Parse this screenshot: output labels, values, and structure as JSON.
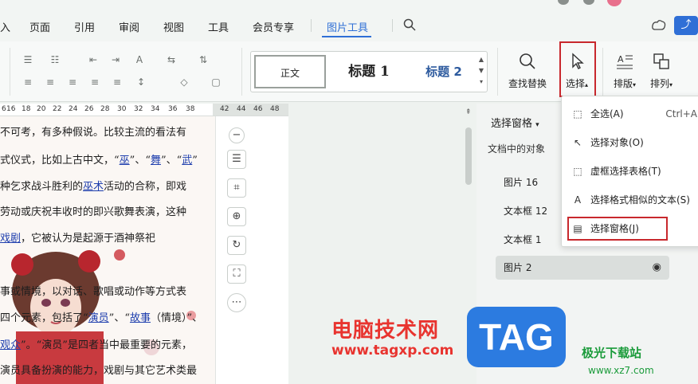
{
  "menu": {
    "items": [
      "入",
      "页面",
      "引用",
      "审阅",
      "视图",
      "工具",
      "会员专享",
      "图片工具"
    ],
    "active_index": 7
  },
  "ribbon": {
    "styles": {
      "normal": "正文",
      "heading1": "标题 1",
      "heading2": "标题 2"
    },
    "find_replace": "查找替换",
    "select": "选择",
    "arrange_text": "排版",
    "arrange": "排列"
  },
  "ruler": {
    "numbers": [
      "6",
      "16",
      "18",
      "20",
      "22",
      "24",
      "26",
      "28",
      "30",
      "32",
      "34",
      "36",
      "38",
      "42",
      "44",
      "46",
      "48"
    ]
  },
  "document": {
    "lines": [
      {
        "parts": [
          {
            "t": "不可考，有多种假说。比较主流的看法有"
          }
        ]
      },
      {
        "parts": [
          {
            "t": "式仪式，比如上古中文，“"
          },
          {
            "t": "巫",
            "link": true
          },
          {
            "t": "”、“"
          },
          {
            "t": "舞",
            "link": true
          },
          {
            "t": "”、“"
          },
          {
            "t": "武",
            "link": true
          },
          {
            "t": "”"
          }
        ]
      },
      {
        "parts": [
          {
            "t": "种乞求战斗胜利的"
          },
          {
            "t": "巫术",
            "link": true
          },
          {
            "t": "活动的合称，即戏"
          }
        ]
      },
      {
        "parts": [
          {
            "t": "劳动或庆祝丰收时的即兴歌舞表演，这种"
          }
        ]
      },
      {
        "parts": [
          {
            "t": "戏剧",
            "link": true
          },
          {
            "t": "，它被认为是起源于酒神祭祀"
          }
        ]
      },
      {
        "parts": [
          {
            "t": "事或情境，以对话、歌唱或动作等方式表"
          }
        ]
      },
      {
        "parts": [
          {
            "t": "四个元素，包括了“"
          },
          {
            "t": "演员",
            "link": true
          },
          {
            "t": "”、“"
          },
          {
            "t": "故事",
            "link": true
          },
          {
            "t": "（情境）”、"
          }
        ]
      },
      {
        "parts": [
          {
            "t": "观众",
            "link": true
          },
          {
            "t": "”。“演员”是四者当中最重要的元素，"
          }
        ]
      },
      {
        "parts": [
          {
            "t": "演员具备扮演的能力，戏剧与其它艺术类最"
          }
        ]
      }
    ]
  },
  "pane": {
    "title": "选择窗格",
    "objects_label": "文档中的对象",
    "objects": [
      "图片 16",
      "文本框 12",
      "文本框 1",
      "图片 2"
    ],
    "selected_index": 3
  },
  "dropdown": {
    "items": [
      {
        "label": "全选(A)",
        "shortcut": "Ctrl+A",
        "icon": "select-all-icon"
      },
      {
        "label": "选择对象(O)",
        "shortcut": "",
        "icon": "pointer-icon"
      },
      {
        "label": "虚框选择表格(T)",
        "shortcut": "",
        "icon": "dashed-box-icon"
      },
      {
        "label": "选择格式相似的文本(S)",
        "shortcut": "",
        "icon": "text-format-icon"
      },
      {
        "label": "选择窗格(J)",
        "shortcut": "",
        "icon": "pane-icon"
      }
    ],
    "highlighted_index": 4
  },
  "watermark": {
    "cn": "电脑技术网",
    "url": "www.tagxp.com",
    "tag": "TAG",
    "site": "极光下载站",
    "site_url": "www.xz7.com"
  }
}
